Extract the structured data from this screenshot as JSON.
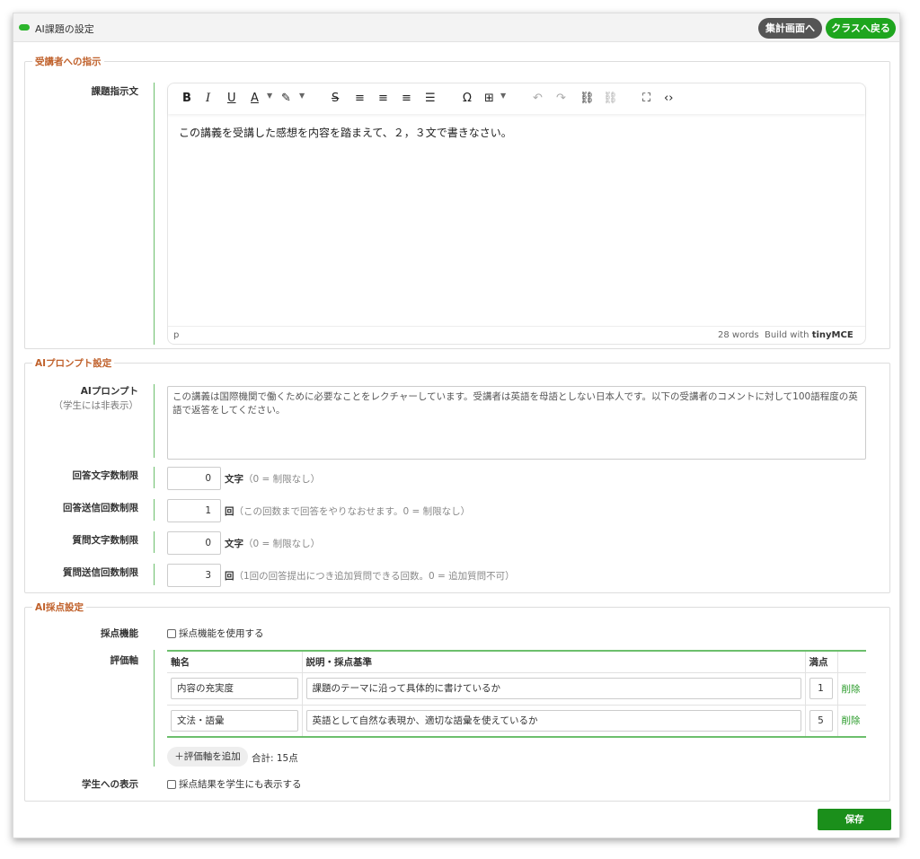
{
  "window": {
    "title": "AI課題の設定",
    "buttons": {
      "summary": "集計画面へ",
      "back_to_class": "クラスへ戻る"
    },
    "accent": "#1ea51e"
  },
  "instructions": {
    "legend": "受講者への指示",
    "label": "課題指示文",
    "editor": {
      "content": "この講義を受講した感想を内容を踏まえて、２，３文で書きなさい。",
      "status_path": "p",
      "word_count": "28 words",
      "build_prefix": "Build with",
      "build_brand": "tinyMCE",
      "toolbar_icons": [
        "bold-icon",
        "italic-icon",
        "underline-icon",
        "text-color-icon",
        "highlight-icon",
        "strikethrough-icon",
        "align-left-icon",
        "align-center-icon",
        "align-right-icon",
        "justify-icon",
        "special-char-icon",
        "table-icon",
        "undo-icon",
        "redo-icon",
        "link-icon",
        "unlink-icon",
        "fullscreen-icon",
        "source-code-icon"
      ]
    }
  },
  "prompt_settings": {
    "legend": "AIプロンプト設定",
    "prompt_label": "AIプロンプト",
    "prompt_sublabel": "（学生には非表示）",
    "prompt_text": "この講義は国際機関で働くために必要なことをレクチャーしています。受講者は英語を母語としない日本人です。以下の受講者のコメントに対して100語程度の英語で返答をしてください。",
    "fields": [
      {
        "label": "回答文字数制限",
        "value": "0",
        "unit": "文字",
        "note": "（0 = 制限なし）"
      },
      {
        "label": "回答送信回数制限",
        "value": "1",
        "unit": "回",
        "note": "（この回数まで回答をやりなおせます。0 = 制限なし）"
      },
      {
        "label": "質問文字数制限",
        "value": "0",
        "unit": "文字",
        "note": "（0 = 制限なし）"
      },
      {
        "label": "質問送信回数制限",
        "value": "3",
        "unit": "回",
        "note": "（1回の回答提出につき追加質問できる回数。0 = 追加質問不可）"
      }
    ]
  },
  "grading": {
    "legend": "AI採点設定",
    "feature_label": "採点機能",
    "feature_checkbox": "採点機能を使用する",
    "axes_label": "評価軸",
    "columns": [
      "軸名",
      "説明・採点基準",
      "満点"
    ],
    "rows": [
      {
        "name": "内容の充実度",
        "criteria": "課題のテーマに沿って具体的に書けているか",
        "score": "1",
        "delete": "削除"
      },
      {
        "name": "文法・語彙",
        "criteria": "英語として自然な表現か、適切な語彙を使えているか",
        "score": "5",
        "delete": "削除"
      }
    ],
    "add_button": "＋評価軸を追加",
    "total": "合計: 15点",
    "display_label": "学生への表示",
    "display_checkbox": "採点結果を学生にも表示する"
  },
  "save_button": "保存"
}
